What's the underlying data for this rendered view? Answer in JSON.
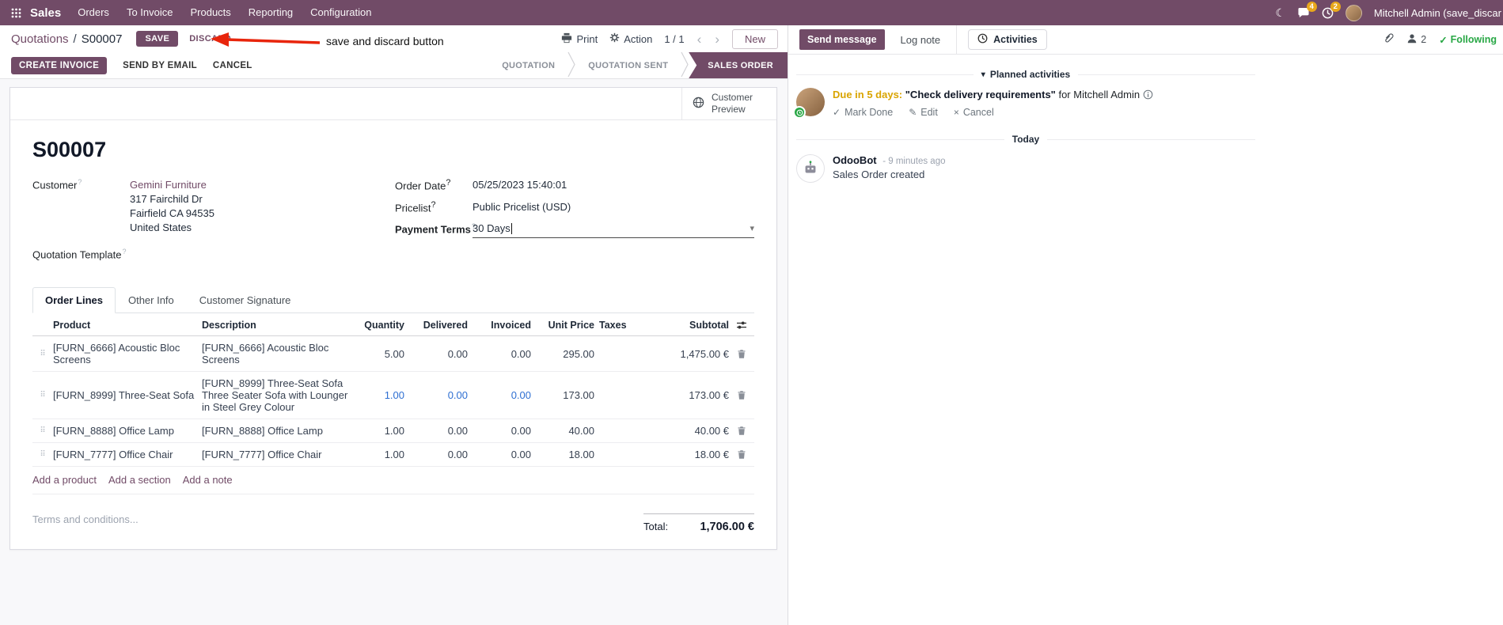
{
  "navbar": {
    "app_name": "Sales",
    "menus": [
      "Orders",
      "To Invoice",
      "Products",
      "Reporting",
      "Configuration"
    ],
    "messages_badge": "4",
    "activities_badge": "2",
    "user_name": "Mitchell Admin (save_discar"
  },
  "annotation": {
    "text": "save and discard button"
  },
  "breadcrumb": {
    "parent": "Quotations",
    "separator": "/",
    "current": "S00007",
    "save": "SAVE",
    "discard": "DISCARD",
    "print": "Print",
    "action": "Action",
    "pager": "1 / 1",
    "new": "New"
  },
  "statusbar": {
    "create_invoice": "CREATE INVOICE",
    "send_by_email": "SEND BY EMAIL",
    "cancel": "CANCEL",
    "states": [
      "QUOTATION",
      "QUOTATION SENT",
      "SALES ORDER"
    ],
    "active_state": "SALES ORDER"
  },
  "form": {
    "customer_preview": "Customer Preview",
    "title": "S00007",
    "customer_label": "Customer",
    "customer_name": "Gemini Furniture",
    "address": [
      "317 Fairchild Dr",
      "Fairfield CA 94535",
      "United States"
    ],
    "quotation_template_label": "Quotation Template",
    "order_date_label": "Order Date",
    "order_date": "05/25/2023 15:40:01",
    "pricelist_label": "Pricelist",
    "pricelist": "Public Pricelist (USD)",
    "payment_terms_label": "Payment Terms",
    "payment_terms": "30 Days",
    "tabs": [
      "Order Lines",
      "Other Info",
      "Customer Signature"
    ],
    "table": {
      "headers": [
        "Product",
        "Description",
        "Quantity",
        "Delivered",
        "Invoiced",
        "Unit Price",
        "Taxes",
        "Subtotal"
      ],
      "rows": [
        {
          "product": "[FURN_6666] Acoustic Bloc Screens",
          "description": "[FURN_6666] Acoustic Bloc Screens",
          "description2": "",
          "quantity": "5.00",
          "delivered": "0.00",
          "invoiced": "0.00",
          "unit_price": "295.00",
          "taxes": "",
          "subtotal": "1,475.00 €",
          "highlight": false
        },
        {
          "product": "[FURN_8999] Three-Seat Sofa",
          "description": "[FURN_8999] Three-Seat Sofa",
          "description2": "Three Seater Sofa with Lounger in Steel Grey Colour",
          "quantity": "1.00",
          "delivered": "0.00",
          "invoiced": "0.00",
          "unit_price": "173.00",
          "taxes": "",
          "subtotal": "173.00 €",
          "highlight": true
        },
        {
          "product": "[FURN_8888] Office Lamp",
          "description": "[FURN_8888] Office Lamp",
          "description2": "",
          "quantity": "1.00",
          "delivered": "0.00",
          "invoiced": "0.00",
          "unit_price": "40.00",
          "taxes": "",
          "subtotal": "40.00 €",
          "highlight": false
        },
        {
          "product": "[FURN_7777] Office Chair",
          "description": "[FURN_7777] Office Chair",
          "description2": "",
          "quantity": "1.00",
          "delivered": "0.00",
          "invoiced": "0.00",
          "unit_price": "18.00",
          "taxes": "",
          "subtotal": "18.00 €",
          "highlight": false
        }
      ],
      "add_links": [
        "Add a product",
        "Add a section",
        "Add a note"
      ]
    },
    "terms_placeholder": "Terms and conditions...",
    "total_label": "Total:",
    "total_value": "1,706.00 €"
  },
  "chatter": {
    "send_message": "Send message",
    "log_note": "Log note",
    "activities_tab": "Activities",
    "followers_count": "2",
    "following": "Following",
    "planned_header": "Planned activities",
    "activity": {
      "due": "Due in 5 days:",
      "title": "\"Check delivery requirements\"",
      "assignee": "for Mitchell Admin",
      "mark_done": "Mark Done",
      "edit": "Edit",
      "cancel": "Cancel"
    },
    "today_divider": "Today",
    "message": {
      "author": "OdooBot",
      "time": "- 9 minutes ago",
      "body": "Sales Order created"
    }
  },
  "misc": {
    "help": "?"
  }
}
